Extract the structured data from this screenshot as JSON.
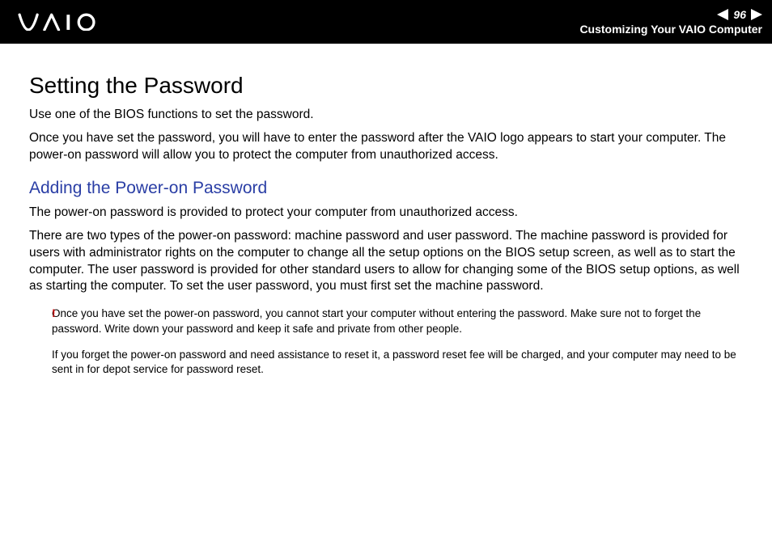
{
  "header": {
    "page_number": "96",
    "section": "Customizing Your VAIO Computer"
  },
  "content": {
    "title": "Setting the Password",
    "intro1": "Use one of the BIOS functions to set the password.",
    "intro2": "Once you have set the password, you will have to enter the password after the VAIO logo appears to start your computer. The power-on password will allow you to protect the computer from unauthorized access.",
    "subheading": "Adding the Power-on Password",
    "sub_p1": "The power-on password is provided to protect your computer from unauthorized access.",
    "sub_p2": "There are two types of the power-on password: machine password and user password. The machine password is provided for users with administrator rights on the computer to change all the setup options on the BIOS setup screen, as well as to start the computer. The user password is provided for other standard users to allow for changing some of the BIOS setup options, as well as starting the computer. To set the user password, you must first set the machine password.",
    "warning_mark": "!",
    "warning1": "Once you have set the power-on password, you cannot start your computer without entering the password. Make sure not to forget the password. Write down your password and keep it safe and private from other people.",
    "warning2": "If you forget the power-on password and need assistance to reset it, a password reset fee will be charged, and your computer may need to be sent in for depot service for password reset."
  }
}
